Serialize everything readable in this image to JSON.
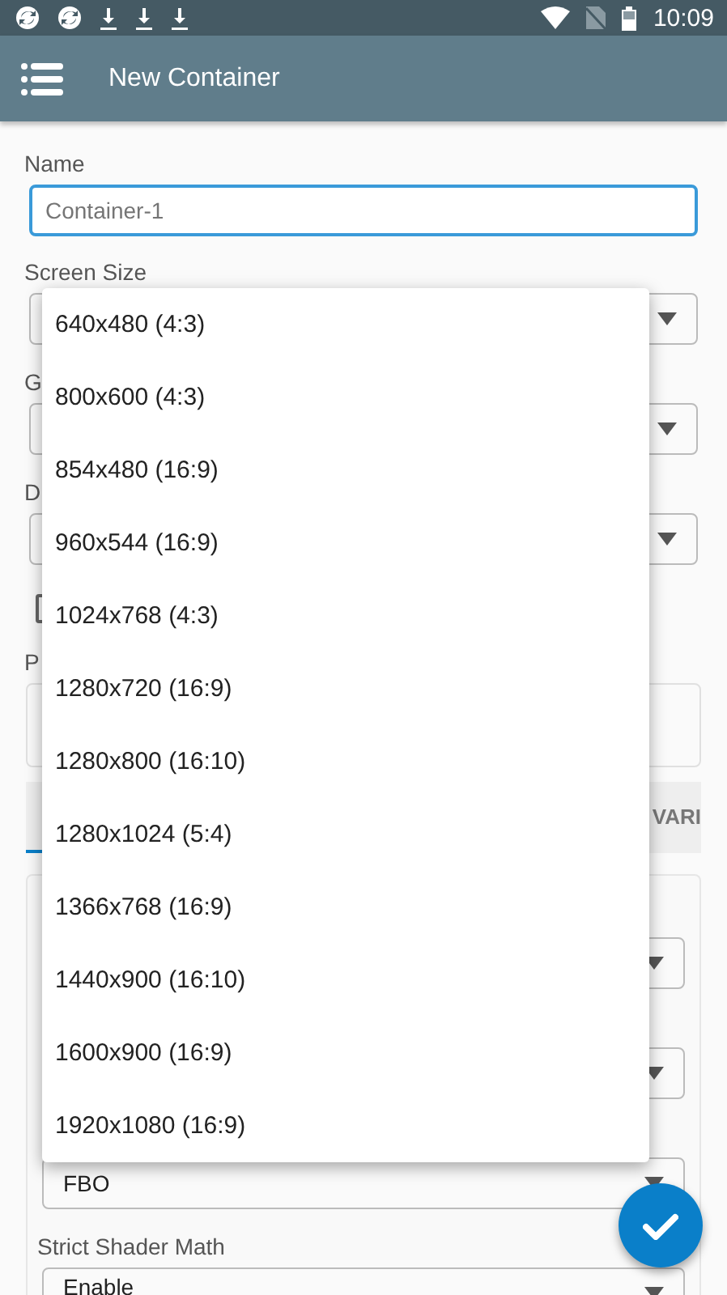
{
  "status_bar": {
    "time": "10:09"
  },
  "app_bar": {
    "title": "New Container"
  },
  "form": [
    {
      "kind": "text",
      "label": "Name",
      "placeholder": "Container-1",
      "focused": true
    },
    {
      "kind": "select",
      "label": "Screen Size"
    },
    {
      "kind": "select",
      "label": "G"
    },
    {
      "kind": "select",
      "label": "D"
    },
    {
      "kind": "checkbox",
      "checked": false
    },
    {
      "kind": "area",
      "label": "P"
    }
  ],
  "tabs": [
    {
      "selected": true
    },
    {
      "label": "VARI",
      "selected": false
    }
  ],
  "card": [
    {
      "kind": "select"
    },
    {
      "kind": "select"
    },
    {
      "kind": "select",
      "value": "FBO"
    },
    {
      "kind": "select",
      "label": "Strict Shader Math",
      "value": "Enable"
    }
  ],
  "dropdown": {
    "options": [
      "640x480 (4:3)",
      "800x600 (4:3)",
      "854x480 (16:9)",
      "960x544 (16:9)",
      "1024x768 (4:3)",
      "1280x720 (16:9)",
      "1280x800 (16:10)",
      "1280x1024 (5:4)",
      "1366x768 (16:9)",
      "1440x900 (16:10)",
      "1600x900 (16:9)",
      "1920x1080 (16:9)"
    ]
  }
}
